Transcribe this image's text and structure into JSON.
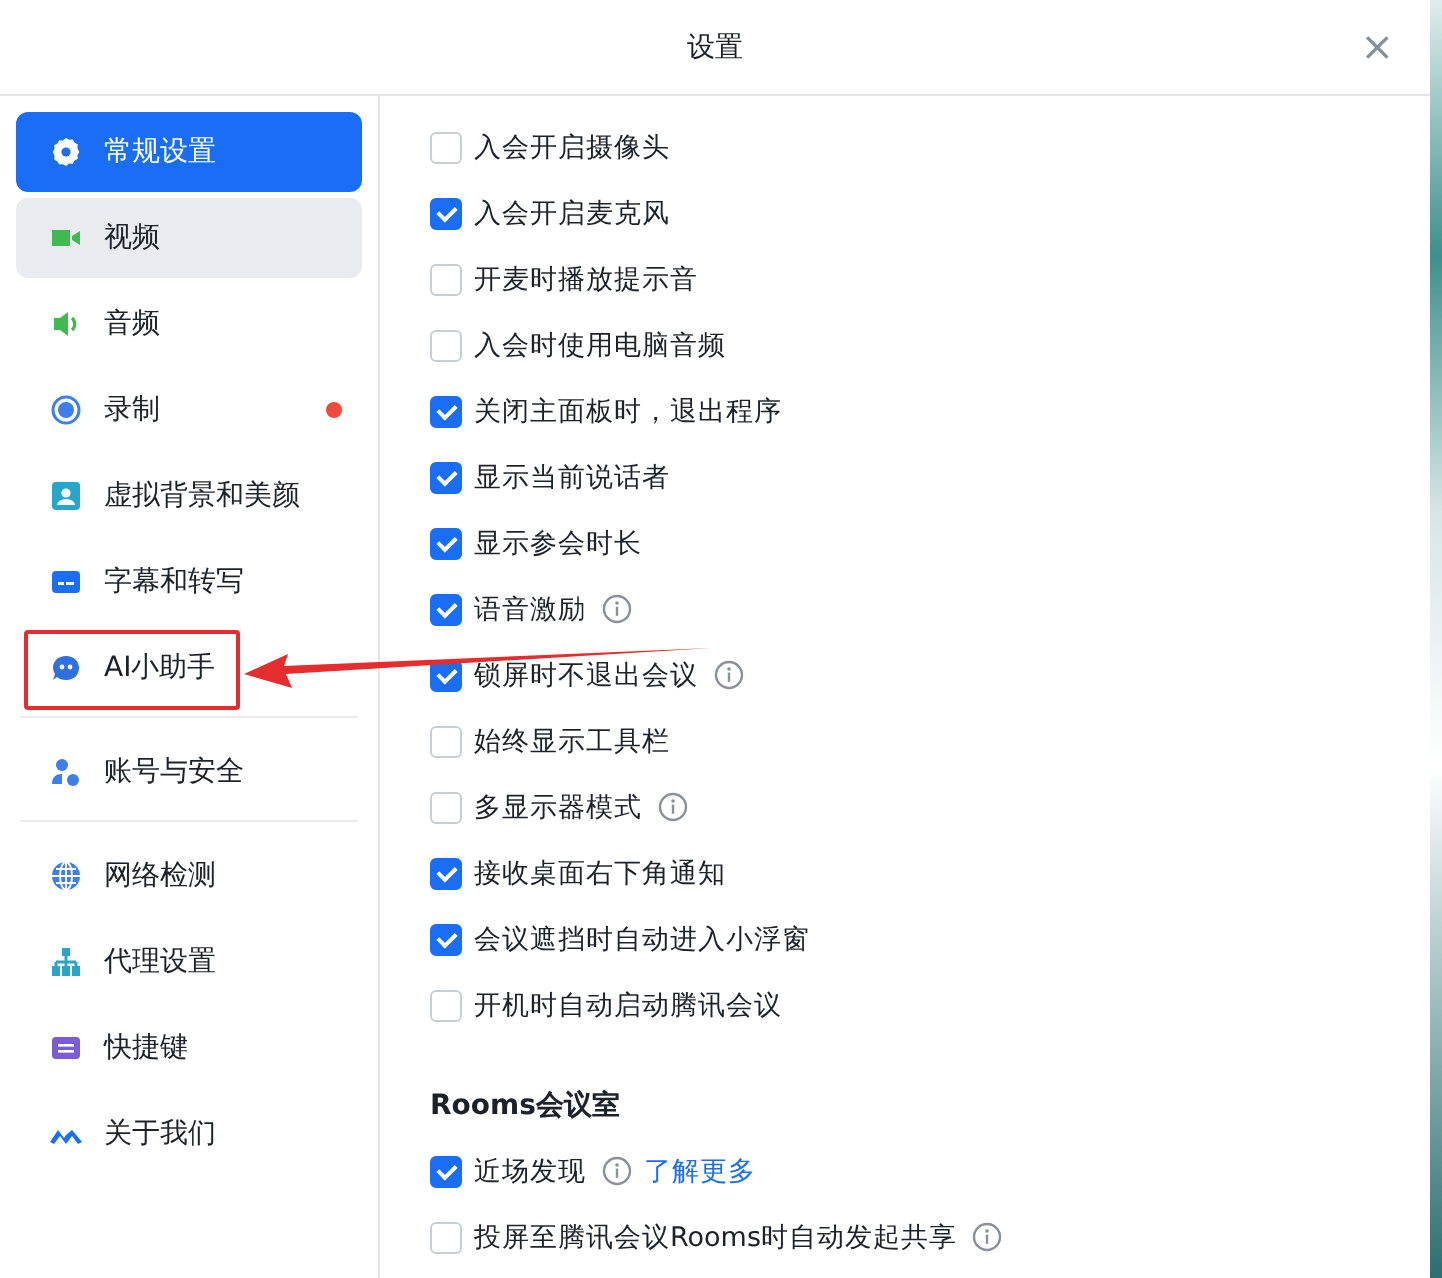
{
  "window": {
    "title": "设置",
    "close": "×"
  },
  "sidebar": {
    "groups": [
      {
        "items": [
          {
            "label": "常规设置",
            "selected": true,
            "hovered": false,
            "badge": false
          },
          {
            "label": "视频",
            "selected": false,
            "hovered": true,
            "badge": false
          },
          {
            "label": "音频",
            "selected": false,
            "hovered": false,
            "badge": false
          },
          {
            "label": "录制",
            "selected": false,
            "hovered": false,
            "badge": true
          },
          {
            "label": "虚拟背景和美颜",
            "selected": false,
            "hovered": false,
            "badge": false
          },
          {
            "label": "字幕和转写",
            "selected": false,
            "hovered": false,
            "badge": false
          },
          {
            "label": "AI小助手",
            "selected": false,
            "hovered": false,
            "badge": false
          }
        ]
      },
      {
        "items": [
          {
            "label": "账号与安全",
            "selected": false,
            "hovered": false,
            "badge": false
          }
        ]
      },
      {
        "items": [
          {
            "label": "网络检测",
            "selected": false,
            "hovered": false,
            "badge": false
          },
          {
            "label": "代理设置",
            "selected": false,
            "hovered": false,
            "badge": false
          },
          {
            "label": "快捷键",
            "selected": false,
            "hovered": false,
            "badge": false
          },
          {
            "label": "关于我们",
            "selected": false,
            "hovered": false,
            "badge": false
          }
        ]
      }
    ]
  },
  "sections": [
    {
      "options": [
        {
          "label": "入会开启摄像头",
          "checked": false,
          "info": false
        },
        {
          "label": "入会开启麦克风",
          "checked": true,
          "info": false
        },
        {
          "label": "开麦时播放提示音",
          "checked": false,
          "info": false
        },
        {
          "label": "入会时使用电脑音频",
          "checked": false,
          "info": false
        },
        {
          "label": "关闭主面板时，退出程序",
          "checked": true,
          "info": false
        },
        {
          "label": "显示当前说话者",
          "checked": true,
          "info": false
        },
        {
          "label": "显示参会时长",
          "checked": true,
          "info": false
        },
        {
          "label": "语音激励",
          "checked": true,
          "info": true
        },
        {
          "label": "锁屏时不退出会议",
          "checked": true,
          "info": true
        },
        {
          "label": "始终显示工具栏",
          "checked": false,
          "info": false
        },
        {
          "label": "多显示器模式",
          "checked": false,
          "info": true
        },
        {
          "label": "接收桌面右下角通知",
          "checked": true,
          "info": false
        },
        {
          "label": "会议遮挡时自动进入小浮窗",
          "checked": true,
          "info": false
        },
        {
          "label": "开机时自动启动腾讯会议",
          "checked": false,
          "info": false
        }
      ]
    },
    {
      "title": "Rooms会议室",
      "options": [
        {
          "label": "近场发现",
          "checked": true,
          "info": true,
          "link": "了解更多"
        },
        {
          "label": "投屏至腾讯会议Rooms时自动发起共享",
          "checked": false,
          "info": true
        }
      ]
    }
  ]
}
